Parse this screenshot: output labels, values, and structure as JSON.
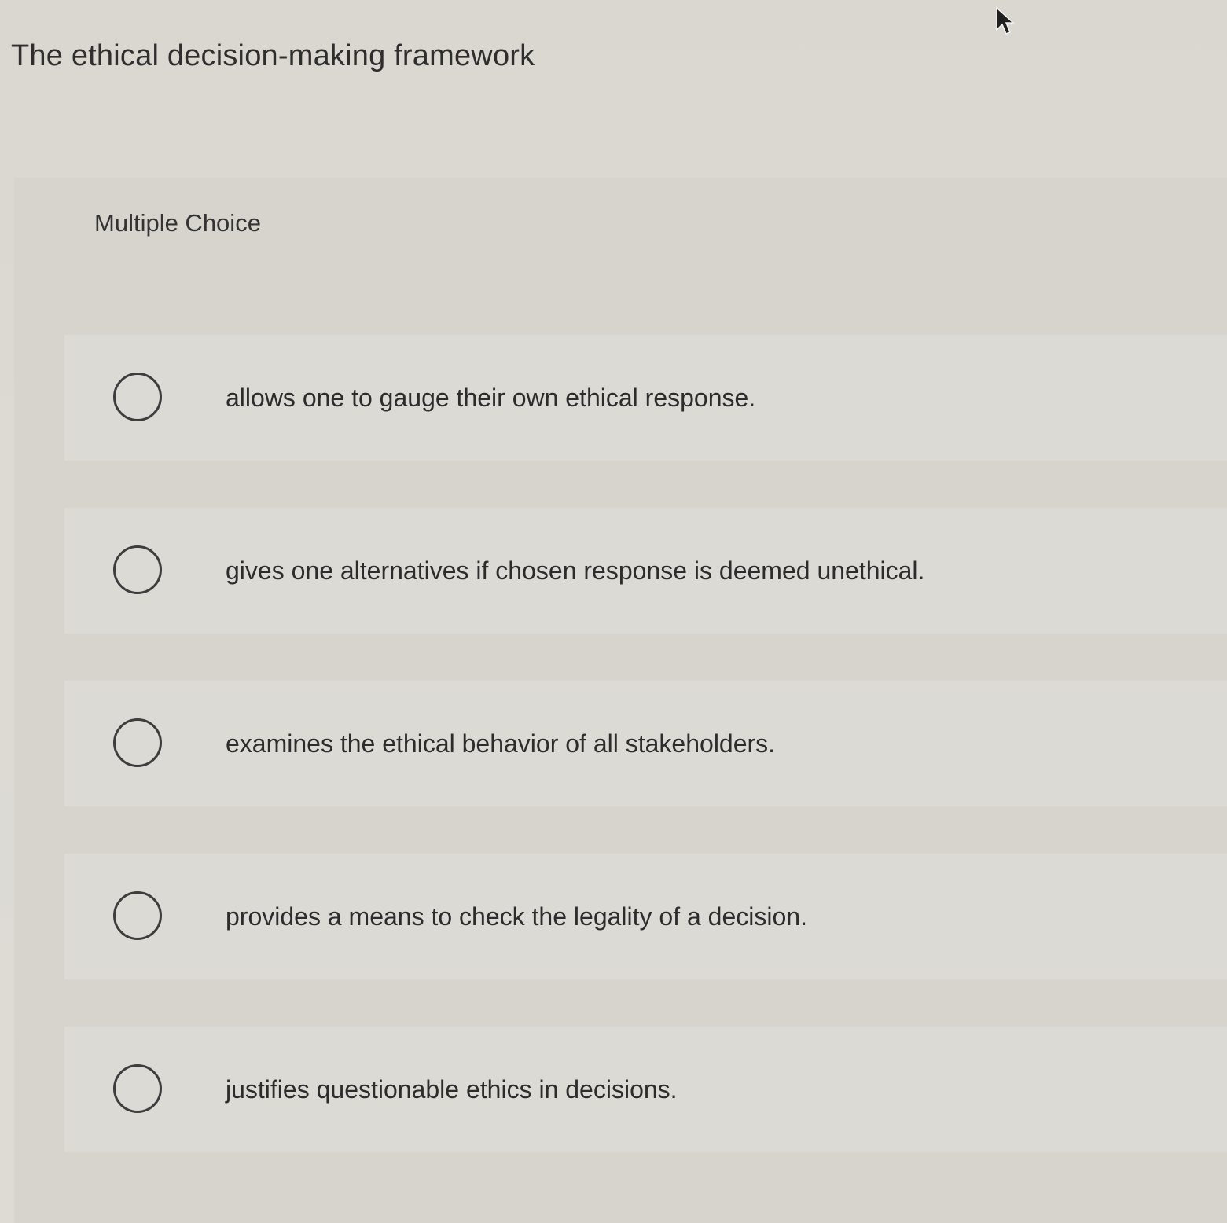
{
  "question": {
    "title": "The ethical decision-making framework"
  },
  "panel": {
    "label": "Multiple Choice"
  },
  "options": [
    {
      "label": "allows one to gauge their own ethical response."
    },
    {
      "label": "gives one alternatives if chosen response is deemed unethical."
    },
    {
      "label": "examines the ethical behavior of all stakeholders."
    },
    {
      "label": "provides a means to check the legality of a decision."
    },
    {
      "label": "justifies questionable ethics in decisions."
    }
  ],
  "icons": {
    "cursor": "mouse-pointer-icon",
    "radio": "radio-button-unselected"
  },
  "colors": {
    "background": "#d9d7cf",
    "text": "#2b2b2b",
    "radio_border": "#3d3d3d"
  }
}
